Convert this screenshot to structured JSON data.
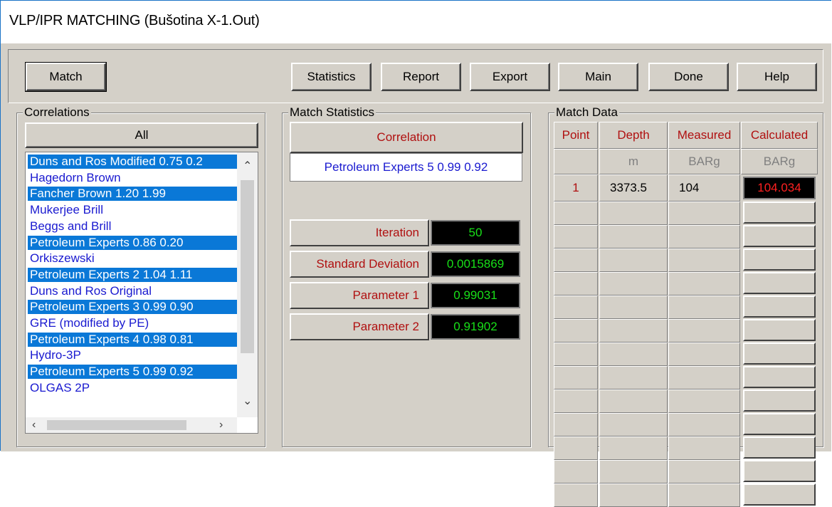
{
  "window": {
    "title": "VLP/IPR MATCHING (Bušotina X-1.Out)"
  },
  "toolbar": {
    "match": "Match",
    "statistics": "Statistics",
    "report": "Report",
    "export": "Export",
    "main": "Main",
    "done": "Done",
    "help": "Help"
  },
  "correlations": {
    "title": "Correlations",
    "all_label": "All",
    "items": [
      {
        "label": "Duns and Ros Modified 0.75 0.2",
        "selected": true
      },
      {
        "label": "Hagedorn Brown",
        "selected": false
      },
      {
        "label": "Fancher Brown 1.20 1.99",
        "selected": true
      },
      {
        "label": "Mukerjee Brill",
        "selected": false
      },
      {
        "label": "Beggs and Brill",
        "selected": false
      },
      {
        "label": "Petroleum Experts 0.86 0.20",
        "selected": true
      },
      {
        "label": "Orkiszewski",
        "selected": false
      },
      {
        "label": "Petroleum Experts 2 1.04 1.11",
        "selected": true
      },
      {
        "label": "Duns and Ros Original",
        "selected": false
      },
      {
        "label": "Petroleum Experts 3 0.99 0.90",
        "selected": true
      },
      {
        "label": "GRE (modified by PE)",
        "selected": false
      },
      {
        "label": "Petroleum Experts 4 0.98 0.81",
        "selected": true
      },
      {
        "label": "Hydro-3P",
        "selected": false
      },
      {
        "label": "Petroleum Experts 5 0.99 0.92",
        "selected": true
      },
      {
        "label": "OLGAS 2P",
        "selected": false
      }
    ]
  },
  "match_statistics": {
    "title": "Match Statistics",
    "correlation_header": "Correlation",
    "correlation_value": "Petroleum Experts 5 0.99 0.92",
    "rows": [
      {
        "label": "Iteration",
        "value": "50"
      },
      {
        "label": "Standard Deviation",
        "value": "0.0015869"
      },
      {
        "label": "Parameter 1",
        "value": "0.99031"
      },
      {
        "label": "Parameter 2",
        "value": "0.91902"
      }
    ]
  },
  "match_data": {
    "title": "Match Data",
    "headers": [
      "Point",
      "Depth",
      "Measured",
      "Calculated"
    ],
    "units": [
      "",
      "m",
      "BARg",
      "BARg"
    ],
    "rows": [
      {
        "point": "1",
        "depth": "3373.5",
        "measured": "104",
        "calculated": "104.034"
      }
    ]
  },
  "colors": {
    "selection": "#0a78d7",
    "item_text": "#1a1ad0",
    "header_text": "#b01010",
    "value_green": "#18e018",
    "value_red": "#ff2020",
    "face": "#d4d0c8"
  }
}
